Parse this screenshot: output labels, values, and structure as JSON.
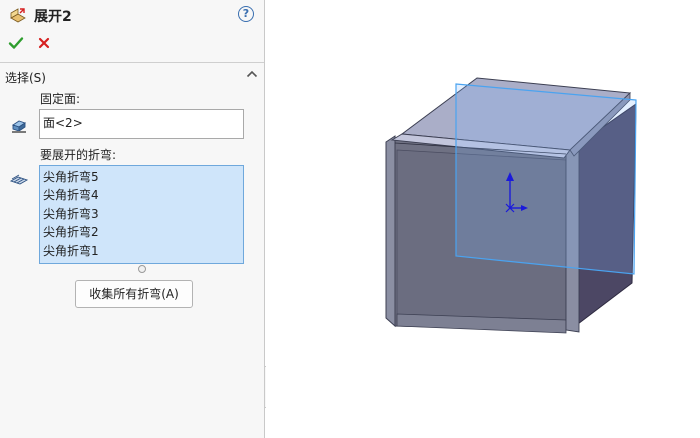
{
  "panel": {
    "title": "展开2",
    "help_label": "?",
    "ok_icon": "checkmark-icon",
    "cancel_icon": "x-icon"
  },
  "selection": {
    "section_title": "选择(S)",
    "fixed_face_label": "固定面:",
    "fixed_face_value": "面<2>",
    "bends_label": "要展开的折弯:",
    "bends": [
      "尖角折弯5",
      "尖角折弯4",
      "尖角折弯3",
      "尖角折弯2",
      "尖角折弯1"
    ],
    "collect_button_label": "收集所有折弯(A)"
  },
  "colors": {
    "accent": "#3a6fb0",
    "ok_green": "#2e9e2e",
    "cancel_red": "#d62020",
    "list_selection": "#cfe5fa",
    "plane_blue": "#4aa3f0",
    "triad_blue": "#1a1adb"
  }
}
